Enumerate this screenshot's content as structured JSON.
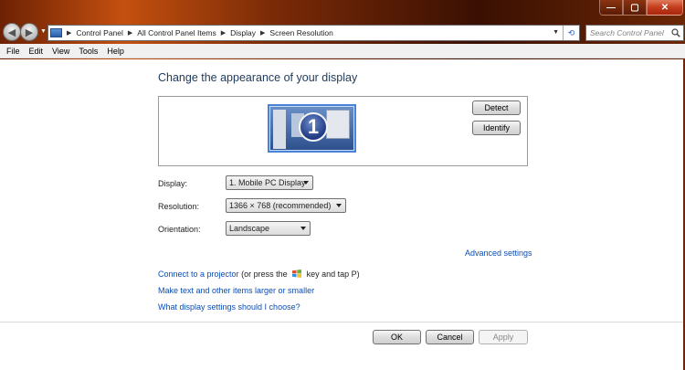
{
  "window": {
    "caption_buttons": {
      "minimize": "—",
      "maximize": "▢",
      "close": "✕"
    }
  },
  "navigation": {
    "back_glyph": "◀",
    "forward_glyph": "▶",
    "breadcrumbs": [
      "Control Panel",
      "All Control Panel Items",
      "Display",
      "Screen Resolution"
    ],
    "search_placeholder": "Search Control Panel"
  },
  "menu": [
    "File",
    "Edit",
    "View",
    "Tools",
    "Help"
  ],
  "main": {
    "heading": "Change the appearance of your display",
    "monitor_number": "1",
    "detect_label": "Detect",
    "identify_label": "Identify",
    "fields": {
      "display": {
        "label": "Display:",
        "value": "1. Mobile PC Display"
      },
      "resolution": {
        "label": "Resolution:",
        "value": "1366 × 768 (recommended)"
      },
      "orientation": {
        "label": "Orientation:",
        "value": "Landscape"
      }
    },
    "advanced_settings": "Advanced settings",
    "projector_link": "Connect to a projector",
    "projector_text_before": "(or press the",
    "projector_text_after": "key and tap P)",
    "text_size_link": "Make text and other items larger or smaller",
    "help_link": "What display settings should I choose?"
  },
  "footer": {
    "ok_label": "OK",
    "cancel_label": "Cancel",
    "apply_label": "Apply"
  },
  "colors": {
    "link": "#0b4db4",
    "heading": "#1e395b",
    "glass_frame": "#c4500f"
  }
}
